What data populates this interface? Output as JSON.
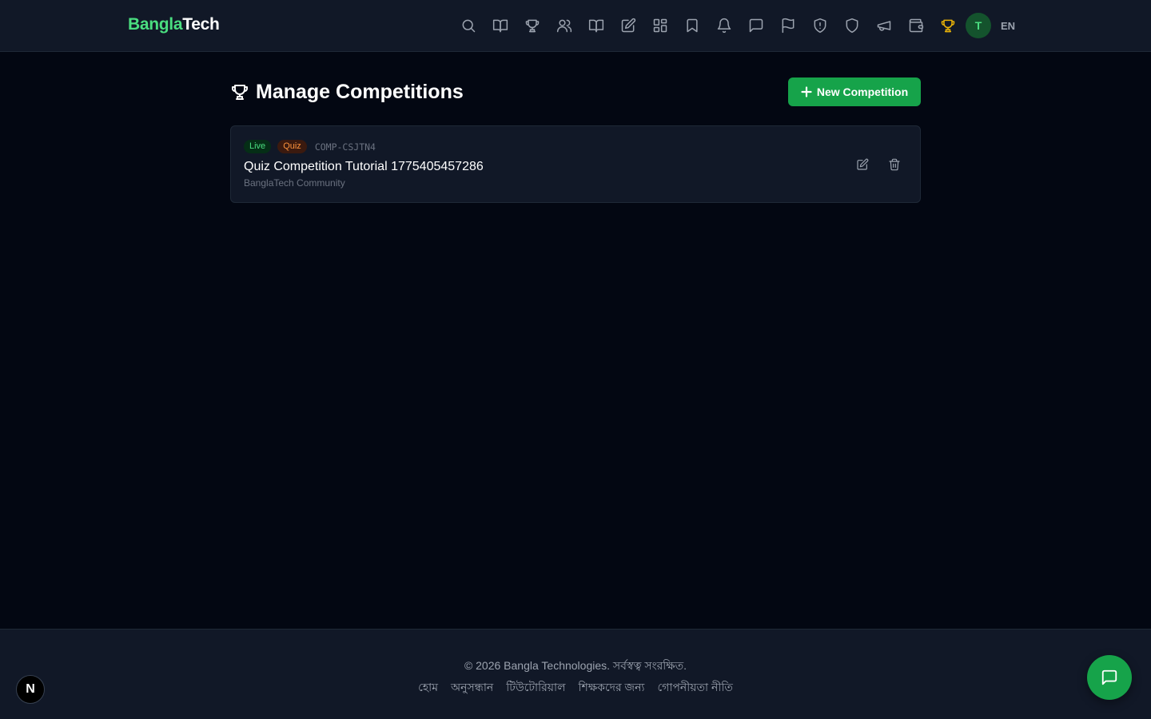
{
  "brand": {
    "part1": "Bangla",
    "part2": "Tech"
  },
  "nav": {
    "icons": [
      "search-icon",
      "book-open-icon",
      "trophy-icon",
      "users-icon",
      "book-open-icon",
      "edit-icon",
      "grid-icon",
      "bookmark-icon",
      "bell-icon",
      "message-icon",
      "flag-icon",
      "shield-alert-icon",
      "shield-icon",
      "megaphone-icon",
      "wallet-icon",
      "trophy-icon"
    ],
    "active_icon": "trophy-icon",
    "avatar_letter": "T",
    "language": "EN"
  },
  "page": {
    "title": "Manage Competitions",
    "new_button": "New Competition"
  },
  "competitions": [
    {
      "status": "Live",
      "type": "Quiz",
      "code": "COMP-CSJTN4",
      "title": "Quiz Competition Tutorial 1775405457286",
      "organizer": "BanglaTech Community"
    }
  ],
  "footer": {
    "copyright": "© 2026 Bangla Technologies. সর্বস্বত্ব সংরক্ষিত.",
    "links": [
      "হোম",
      "অনুসন্ধান",
      "টিউটোরিয়াল",
      "শিক্ষকদের জন্য",
      "গোপনীয়তা নীতি"
    ]
  },
  "colors": {
    "accent": "#16a34a",
    "brand_green": "#4ade80",
    "active_icon": "#eab308",
    "background": "#030712",
    "surface": "#111827"
  },
  "dev_badge": "N"
}
